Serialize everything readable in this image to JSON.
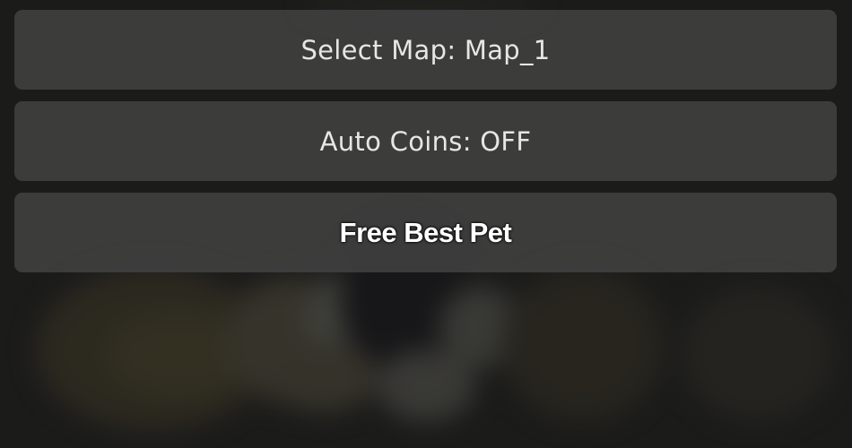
{
  "menu": {
    "items": [
      {
        "label": "Select Map: Map_1",
        "style": "normal"
      },
      {
        "label": "Auto Coins: OFF",
        "style": "normal"
      },
      {
        "label": "Free Best Pet",
        "style": "bold"
      }
    ]
  },
  "colors": {
    "background": "#242423",
    "button": "#3e3e3e",
    "text": "#e6e6e6",
    "bold_text": "#ffffff"
  }
}
